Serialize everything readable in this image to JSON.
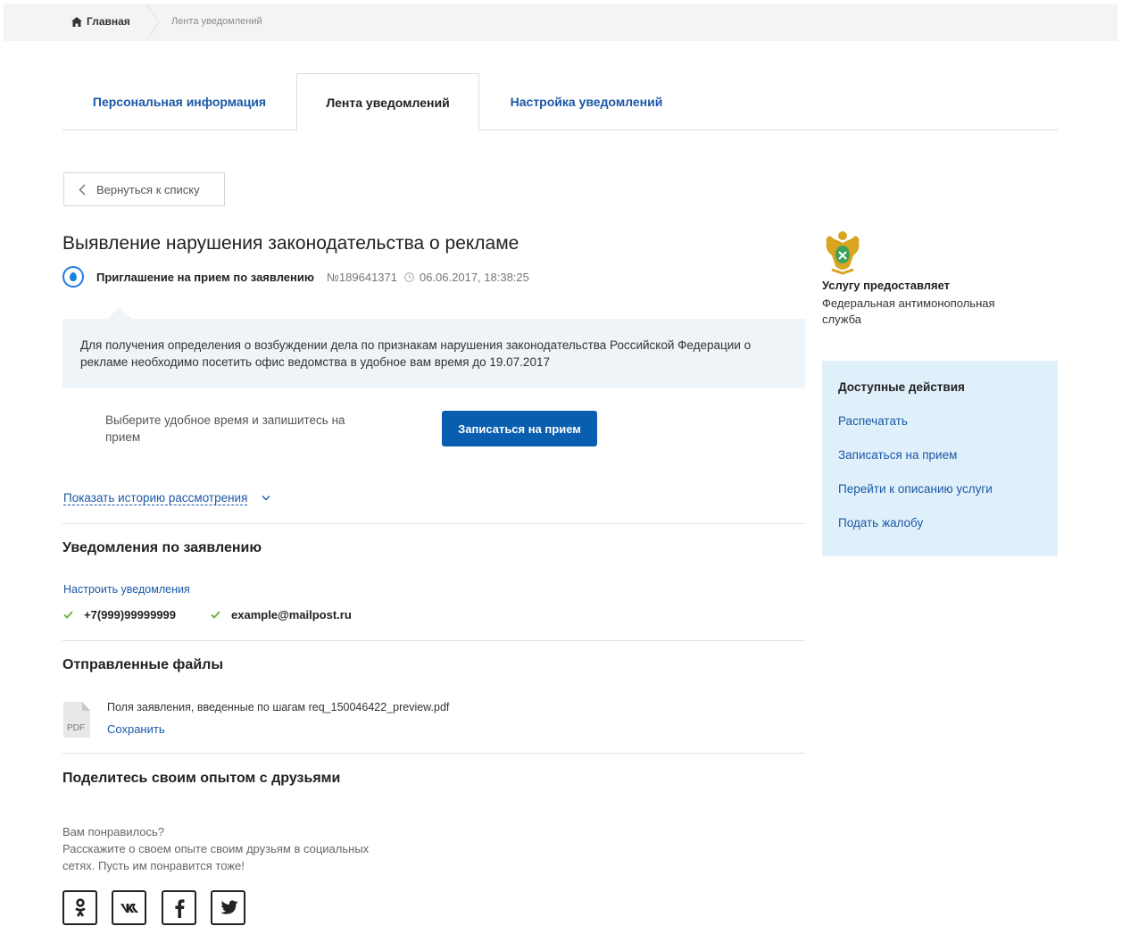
{
  "breadcrumb": {
    "home": "Главная",
    "current": "Лента уведомлений"
  },
  "tabs": [
    {
      "label": "Персональная информация",
      "active": false
    },
    {
      "label": "Лента уведомлений",
      "active": true
    },
    {
      "label": "Настройка уведомлений",
      "active": false
    }
  ],
  "back_button": "Вернуться к списку",
  "title": "Выявление нарушения законодательства о рекламе",
  "meta": {
    "type": "Приглашение на прием по заявлению",
    "number": "№189641371",
    "date": "06.06.2017, 18:38:25"
  },
  "notice": "Для получения определения о возбуждении дела по признакам нарушения законодательства Российской Федерации о рекламе необходимо посетить офис ведомства в удобное вам время до 19.07.2017",
  "booking": {
    "text": "Выберите удобное время и запишитесь на прием",
    "button": "Записаться на прием"
  },
  "history_link": "Показать историю рассмотрения",
  "notifications": {
    "heading": "Уведомления по заявлению",
    "configure_link": "Настроить уведомления",
    "phone": "+7(999)99999999",
    "email": "example@mailpost.ru"
  },
  "files": {
    "heading": "Отправленные файлы",
    "file_type": "PDF",
    "file_name": "Поля заявления, введенные по шагам req_150046422_preview.pdf",
    "save_link": "Сохранить"
  },
  "share": {
    "heading": "Поделитесь своим опытом с друзьями",
    "line1": "Вам понравилось?",
    "line2": "Расскажите о своем опыте своим друзьям в социальных",
    "line3": "сетях. Пусть им понравится тоже!",
    "icons": [
      "odnoklassniki-icon",
      "vk-icon",
      "facebook-icon",
      "twitter-icon"
    ]
  },
  "provider": {
    "heading": "Услугу предоставляет",
    "name": "Федеральная антимонопольная служба"
  },
  "actions": {
    "heading": "Доступные действия",
    "items": [
      "Распечатать",
      "Записаться на прием",
      "Перейти к описанию услуги",
      "Подать жалобу"
    ]
  },
  "colors": {
    "link": "#1b58a7",
    "primary_button": "#0a5eb0",
    "notice_bg": "#eef4f8",
    "actions_bg": "#e0f0fa",
    "check": "#7ab23f"
  }
}
